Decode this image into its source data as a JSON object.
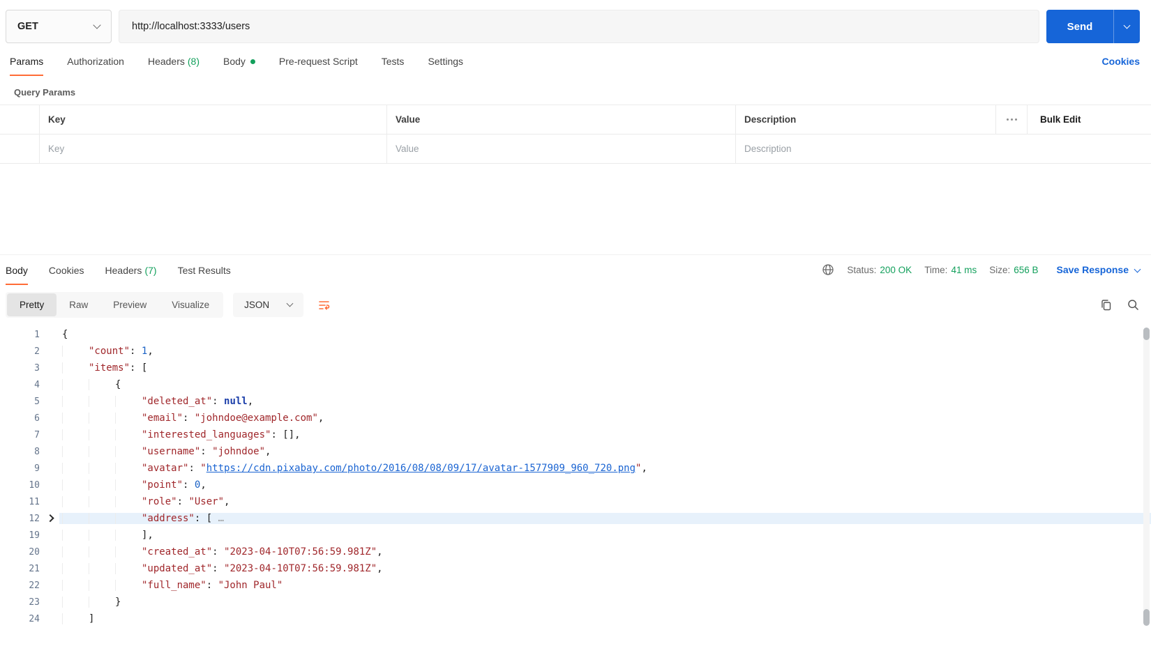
{
  "request": {
    "method": "GET",
    "url": "http://localhost:3333/users",
    "send_label": "Send",
    "tabs": [
      {
        "label": "Params"
      },
      {
        "label": "Authorization"
      },
      {
        "label": "Headers",
        "count": "(8)"
      },
      {
        "label": "Body",
        "modified_dot": true
      },
      {
        "label": "Pre-request Script"
      },
      {
        "label": "Tests"
      },
      {
        "label": "Settings"
      }
    ],
    "cookies_link": "Cookies",
    "query_params_title": "Query Params",
    "params_table": {
      "columns": [
        "Key",
        "Value",
        "Description"
      ],
      "bulk_edit_label": "Bulk Edit",
      "row_placeholders": {
        "key": "Key",
        "value": "Value",
        "description": "Description"
      }
    }
  },
  "response": {
    "tabs": [
      {
        "label": "Body"
      },
      {
        "label": "Cookies"
      },
      {
        "label": "Headers",
        "count": "(7)"
      },
      {
        "label": "Test Results"
      }
    ],
    "meta": {
      "status_label": "Status:",
      "status_value": "200 OK",
      "time_label": "Time:",
      "time_value": "41 ms",
      "size_label": "Size:",
      "size_value": "656 B",
      "save_response_label": "Save Response"
    },
    "view_modes": [
      "Pretty",
      "Raw",
      "Preview",
      "Visualize"
    ],
    "language_select": "JSON",
    "code_lines": [
      {
        "num": 1,
        "indent": 0,
        "tokens": [
          [
            "p",
            "{"
          ]
        ]
      },
      {
        "num": 2,
        "indent": 1,
        "tokens": [
          [
            "k",
            "\"count\""
          ],
          [
            "p",
            ": "
          ],
          [
            "n",
            "1"
          ],
          [
            "p",
            ","
          ]
        ]
      },
      {
        "num": 3,
        "indent": 1,
        "tokens": [
          [
            "k",
            "\"items\""
          ],
          [
            "p",
            ": ["
          ]
        ]
      },
      {
        "num": 4,
        "indent": 2,
        "tokens": [
          [
            "p",
            "{"
          ]
        ]
      },
      {
        "num": 5,
        "indent": 3,
        "tokens": [
          [
            "k",
            "\"deleted_at\""
          ],
          [
            "p",
            ": "
          ],
          [
            "u",
            "null"
          ],
          [
            "p",
            ","
          ]
        ]
      },
      {
        "num": 6,
        "indent": 3,
        "tokens": [
          [
            "k",
            "\"email\""
          ],
          [
            "p",
            ": "
          ],
          [
            "s",
            "\"johndoe@example.com\""
          ],
          [
            "p",
            ","
          ]
        ]
      },
      {
        "num": 7,
        "indent": 3,
        "tokens": [
          [
            "k",
            "\"interested_languages\""
          ],
          [
            "p",
            ": "
          ],
          [
            "p",
            "[],"
          ]
        ]
      },
      {
        "num": 8,
        "indent": 3,
        "tokens": [
          [
            "k",
            "\"username\""
          ],
          [
            "p",
            ": "
          ],
          [
            "s",
            "\"johndoe\""
          ],
          [
            "p",
            ","
          ]
        ]
      },
      {
        "num": 9,
        "indent": 3,
        "tokens": [
          [
            "k",
            "\"avatar\""
          ],
          [
            "p",
            ": "
          ],
          [
            "s",
            "\""
          ],
          [
            "l",
            "https://cdn.pixabay.com/photo/2016/08/08/09/17/avatar-1577909_960_720.png"
          ],
          [
            "s",
            "\""
          ],
          [
            "p",
            ","
          ]
        ]
      },
      {
        "num": 10,
        "indent": 3,
        "tokens": [
          [
            "k",
            "\"point\""
          ],
          [
            "p",
            ": "
          ],
          [
            "n",
            "0"
          ],
          [
            "p",
            ","
          ]
        ]
      },
      {
        "num": 11,
        "indent": 3,
        "tokens": [
          [
            "k",
            "\"role\""
          ],
          [
            "p",
            ": "
          ],
          [
            "s",
            "\"User\""
          ],
          [
            "p",
            ","
          ]
        ]
      },
      {
        "num": 12,
        "indent": 3,
        "hl": true,
        "fold": true,
        "tokens": [
          [
            "k",
            "\"address\""
          ],
          [
            "p",
            ": ["
          ],
          [
            "e",
            " …"
          ]
        ]
      },
      {
        "num": 19,
        "indent": 3,
        "tokens": [
          [
            "p",
            "],"
          ]
        ]
      },
      {
        "num": 20,
        "indent": 3,
        "tokens": [
          [
            "k",
            "\"created_at\""
          ],
          [
            "p",
            ": "
          ],
          [
            "s",
            "\"2023-04-10T07:56:59.981Z\""
          ],
          [
            "p",
            ","
          ]
        ]
      },
      {
        "num": 21,
        "indent": 3,
        "tokens": [
          [
            "k",
            "\"updated_at\""
          ],
          [
            "p",
            ": "
          ],
          [
            "s",
            "\"2023-04-10T07:56:59.981Z\""
          ],
          [
            "p",
            ","
          ]
        ]
      },
      {
        "num": 22,
        "indent": 3,
        "tokens": [
          [
            "k",
            "\"full_name\""
          ],
          [
            "p",
            ": "
          ],
          [
            "s",
            "\"John Paul\""
          ]
        ]
      },
      {
        "num": 23,
        "indent": 2,
        "tokens": [
          [
            "p",
            "}"
          ]
        ]
      },
      {
        "num": 24,
        "indent": 1,
        "tokens": [
          [
            "p",
            "]"
          ]
        ]
      }
    ]
  },
  "colors": {
    "accent_orange": "#FF6C37",
    "link_blue": "#1665D8",
    "success_green": "#13A05C",
    "code_key_red": "#A0272B",
    "code_number_blue": "#1A62C5",
    "highlight_row": "#E7F1FB"
  }
}
